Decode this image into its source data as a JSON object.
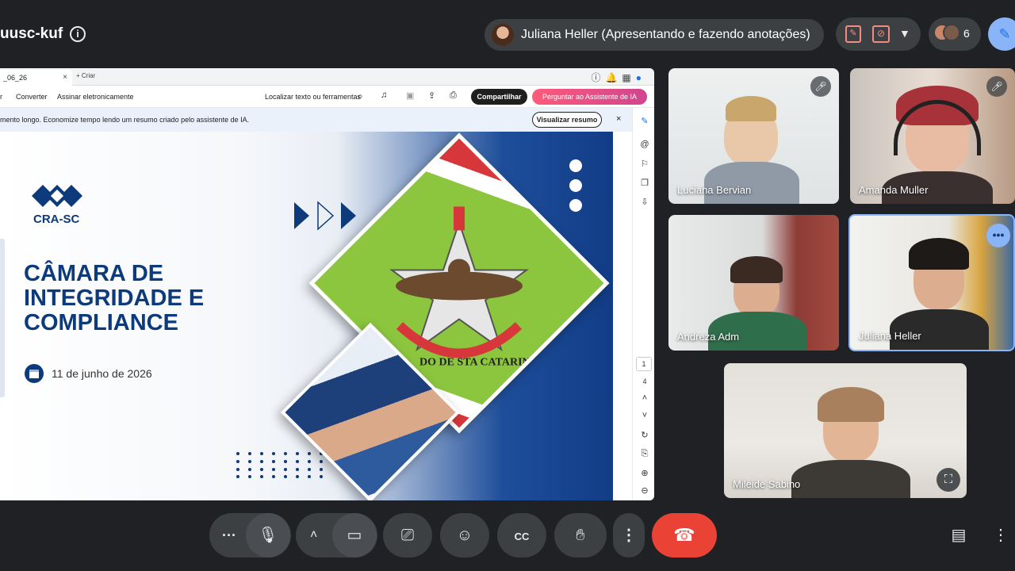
{
  "header": {
    "meeting_code": "uusc-kuf",
    "info_icon": "i",
    "presenter_text": "Juliana Heller (Apresentando e fazendo anotações)",
    "participant_count": "6"
  },
  "pdf": {
    "tab_label": "_06_26",
    "tab_close": "×",
    "new_tab": "+ Criar",
    "toolbar": {
      "item_edit": "r",
      "item_convert": "Converter",
      "item_sign": "Assinar eletronicamente",
      "search_label": "Localizar texto ou ferramentas",
      "share_button": "Compartilhar",
      "ai_button": "Perguntar ao Assistente de IA"
    },
    "banner": {
      "text": "mento longo. Economize tempo lendo um resumo criado pelo assistente de IA.",
      "summary_button": "Visualizar resumo",
      "close": "×"
    },
    "pages": {
      "current": "1",
      "total": "4"
    }
  },
  "slide": {
    "logo_text": "CRA-SC",
    "title_line1": "CÂMARA DE",
    "title_line2": "INTEGRIDADE E",
    "title_line3": "COMPLIANCE",
    "date": "11 de junho de 2026",
    "flag_text": "DO DE STA CATARINA"
  },
  "participants": [
    {
      "name": "Luciana Bervian",
      "muted": true
    },
    {
      "name": "Amanda Muller",
      "muted": true
    },
    {
      "name": "Andreza Adm",
      "muted": false
    },
    {
      "name": "Juliana Heller",
      "muted": false
    },
    {
      "name": "Mileide Sabino",
      "muted": false
    }
  ],
  "colors": {
    "background": "#202124",
    "panel": "#3c4043",
    "hangup": "#ea4335",
    "accent_blue": "#8ab4f8",
    "slide_navy": "#0d3a7a"
  }
}
